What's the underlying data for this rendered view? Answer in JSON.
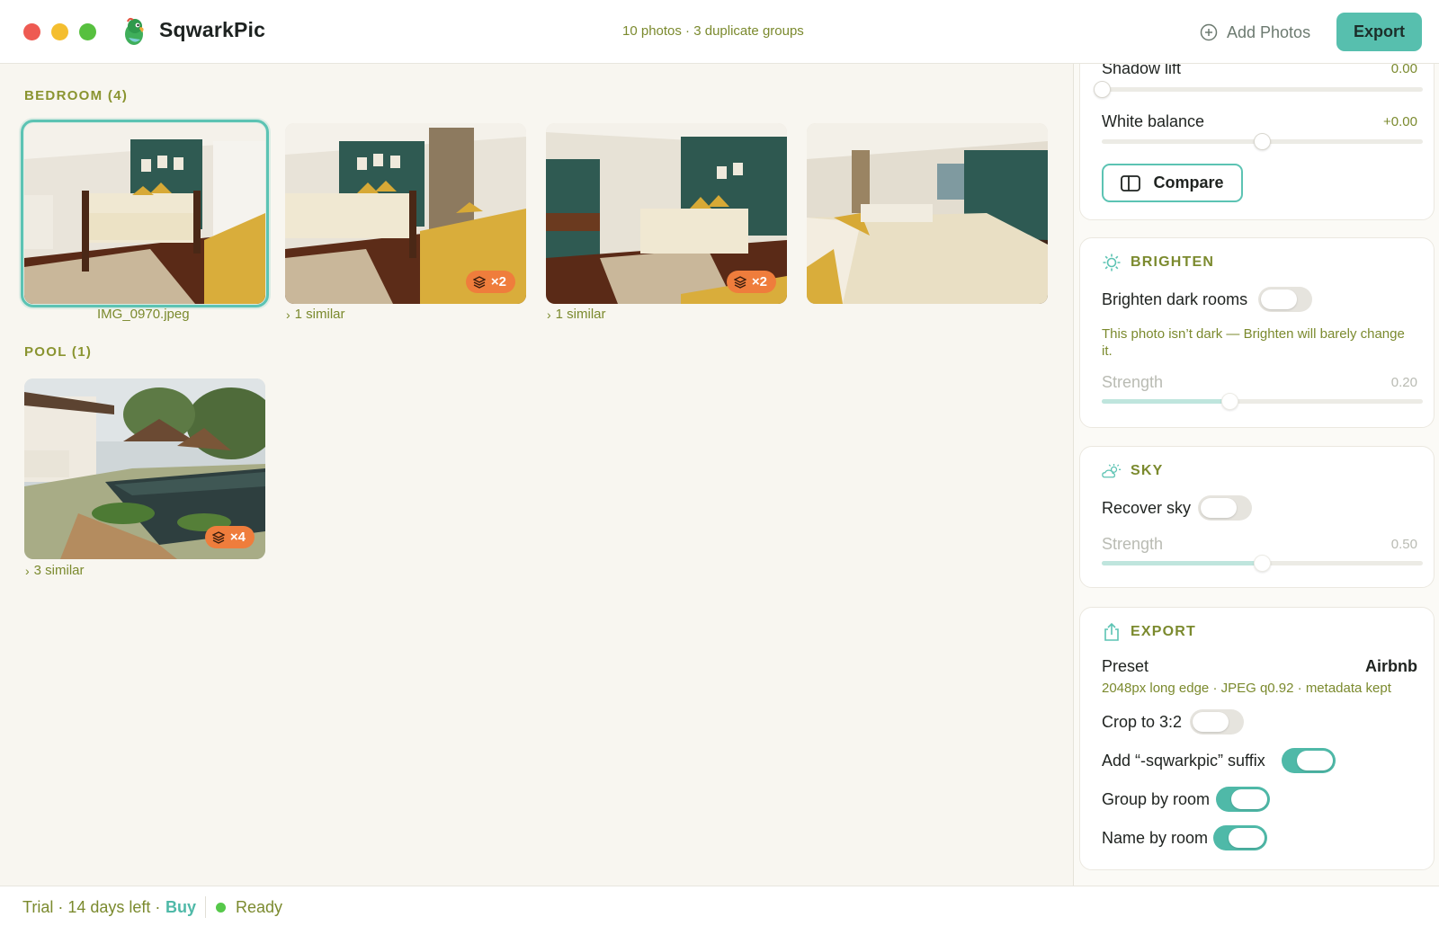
{
  "app": {
    "name": "SqwarkPic",
    "summary": "10 photos · 3 duplicate groups",
    "add_photos_label": "Add Photos",
    "export_label": "Export"
  },
  "groups": [
    {
      "title": "BEDROOM (4)",
      "photos": [
        {
          "caption": "IMG_0970.jpeg",
          "selected": true,
          "badge": "",
          "similar": ""
        },
        {
          "caption": "",
          "selected": false,
          "badge": "×2",
          "similar": "1 similar"
        },
        {
          "caption": "",
          "selected": false,
          "badge": "×2",
          "similar": "1 similar"
        },
        {
          "caption": "",
          "selected": false,
          "badge": "",
          "similar": ""
        }
      ]
    },
    {
      "title": "POOL (1)",
      "photos": [
        {
          "caption": "",
          "selected": false,
          "badge": "×4",
          "similar": "3 similar"
        }
      ]
    }
  ],
  "adjust": {
    "shadow_lift": {
      "label": "Shadow lift",
      "value": "0.00"
    },
    "white_balance": {
      "label": "White balance",
      "value": "+0.00"
    },
    "compare_label": "Compare"
  },
  "brighten": {
    "title": "BRIGHTEN",
    "toggle_label": "Brighten dark rooms",
    "toggle_on": false,
    "note": "This photo isn’t dark — Brighten will barely change it.",
    "strength_label": "Strength",
    "strength_value": "0.20"
  },
  "sky": {
    "title": "SKY",
    "toggle_label": "Recover sky",
    "toggle_on": false,
    "strength_label": "Strength",
    "strength_value": "0.50"
  },
  "export": {
    "title": "EXPORT",
    "preset_label": "Preset",
    "preset_value": "Airbnb",
    "preset_desc": "2048px long edge · JPEG q0.92 · metadata kept",
    "options": [
      {
        "label": "Crop to 3:2",
        "on": false
      },
      {
        "label": "Add “-sqwarkpic” suffix",
        "on": true
      },
      {
        "label": "Group by room",
        "on": true
      },
      {
        "label": "Name by room",
        "on": true
      }
    ]
  },
  "status": {
    "trial": "Trial · 14 days left ·",
    "buy": "Buy",
    "ready": "Ready"
  },
  "colors": {
    "accent": "#57bfae",
    "olive_text": "#7b8a2e",
    "badge": "#ef7d3c",
    "ready": "#56c84a"
  }
}
